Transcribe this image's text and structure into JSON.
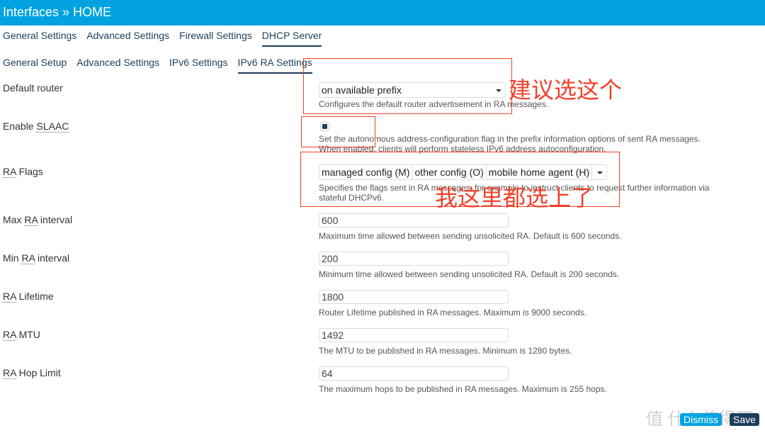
{
  "header": {
    "title": "Interfaces » HOME"
  },
  "main_tabs": [
    {
      "label": "General Settings",
      "active": false
    },
    {
      "label": "Advanced Settings",
      "active": false
    },
    {
      "label": "Firewall Settings",
      "active": false
    },
    {
      "label": "DHCP Server",
      "active": true
    }
  ],
  "sub_tabs": [
    {
      "label": "General Setup",
      "active": false
    },
    {
      "label": "Advanced Settings",
      "active": false
    },
    {
      "label": "IPv6 Settings",
      "active": false
    },
    {
      "label": "IPv6 RA Settings",
      "active": true
    }
  ],
  "fields": {
    "default_router": {
      "label": "Default router",
      "value": "on available prefix",
      "desc": "Configures the default router advertisement in RA messages."
    },
    "enable_slaac": {
      "label_prefix": "Enable ",
      "label_abbr": "SLAAC",
      "checked": true,
      "desc1": "Set the autonomous address-configuration flag in the prefix information options of sent RA messages.",
      "desc2": "When enabled, clients will perform stateless IPv6 address autoconfiguration."
    },
    "ra_flags": {
      "label_abbr": "RA",
      "label_suffix": " Flags",
      "options": [
        "managed config (M)",
        "other config (O)",
        "mobile home agent (H)"
      ],
      "desc1": "Specifies the flags sent in RA messages, for example to instruct clients to request further information via",
      "desc2": "stateful DHCPv6."
    },
    "max_ra_interval": {
      "label_prefix": "Max ",
      "label_abbr": "RA",
      "label_suffix": " interval",
      "value": "600",
      "desc": "Maximum time allowed between sending unsolicited RA. Default is 600 seconds."
    },
    "min_ra_interval": {
      "label_prefix": "Min ",
      "label_abbr": "RA",
      "label_suffix": " interval",
      "value": "200",
      "desc": "Minimum time allowed between sending unsolicited RA. Default is 200 seconds."
    },
    "ra_lifetime": {
      "label_abbr": "RA",
      "label_suffix": " Lifetime",
      "value": "1800",
      "desc": "Router Lifetime published in RA messages. Maximum is 9000 seconds."
    },
    "ra_mtu": {
      "label_abbr": "RA",
      "label_suffix": " MTU",
      "value": "1492",
      "desc": "The MTU to be published in RA messages. Minimum is 1280 bytes."
    },
    "ra_hop_limit": {
      "label_abbr": "RA",
      "label_suffix": " Hop Limit",
      "value": "64",
      "desc": "The maximum hops to be published in RA messages. Maximum is 255 hops."
    }
  },
  "annotations": {
    "recommend": "建议选这个",
    "all_selected": "我这里都选上了"
  },
  "footer": {
    "dismiss": "Dismiss",
    "save": "Save"
  },
  "watermark": "值 什么值得买",
  "colors": {
    "header_bg": "#00a3e0",
    "accent_dark": "#1d3e5a",
    "annotation_red": "#f0412a"
  }
}
